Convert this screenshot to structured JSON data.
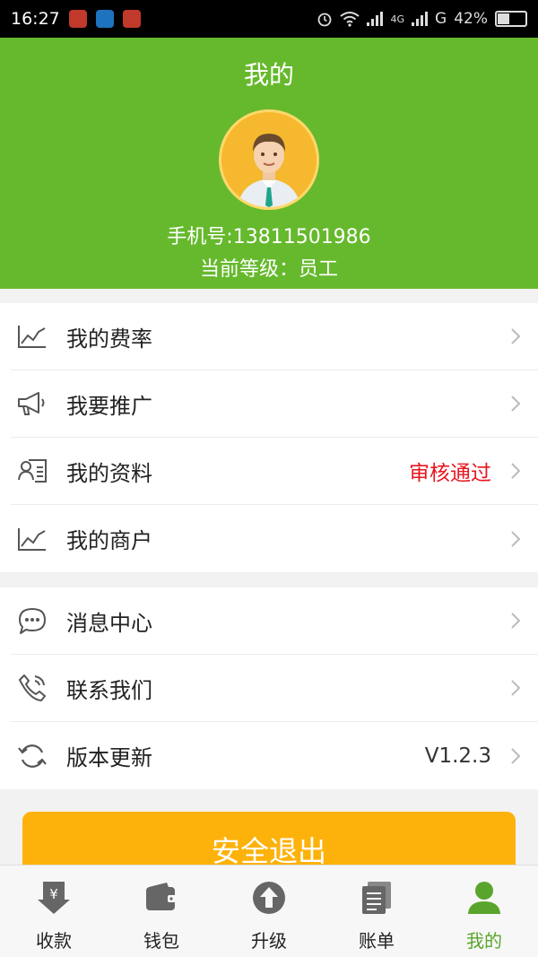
{
  "status_bar": {
    "time": "16:27",
    "network": "4G",
    "carrier2": "G",
    "battery": "42%",
    "battery_level": 0.42
  },
  "header": {
    "title": "我的",
    "phone": "手机号:13811501986",
    "level": "当前等级：员工",
    "bg_color": "#66b92d"
  },
  "menu_group_1": [
    {
      "label": "我的费率",
      "icon": "chart-icon",
      "value": ""
    },
    {
      "label": "我要推广",
      "icon": "megaphone-icon",
      "value": ""
    },
    {
      "label": "我的资料",
      "icon": "profile-card-icon",
      "value": "审核通过"
    },
    {
      "label": "我的商户",
      "icon": "chart-icon",
      "value": ""
    }
  ],
  "menu_group_2": [
    {
      "label": "消息中心",
      "icon": "chat-bubble-icon",
      "value": ""
    },
    {
      "label": "联系我们",
      "icon": "phone-icon",
      "value": ""
    },
    {
      "label": "版本更新",
      "icon": "refresh-icon",
      "value": "V1.2.3"
    }
  ],
  "logout": {
    "label": "安全退出",
    "color": "#fdb20b"
  },
  "tabs": [
    {
      "label": "收款",
      "icon": "yen-download-icon"
    },
    {
      "label": "钱包",
      "icon": "wallet-icon"
    },
    {
      "label": "升级",
      "icon": "upgrade-arrow-icon"
    },
    {
      "label": "账单",
      "icon": "bill-icon"
    },
    {
      "label": "我的",
      "icon": "person-icon",
      "active": true
    }
  ],
  "accent_color": "#59a52c"
}
